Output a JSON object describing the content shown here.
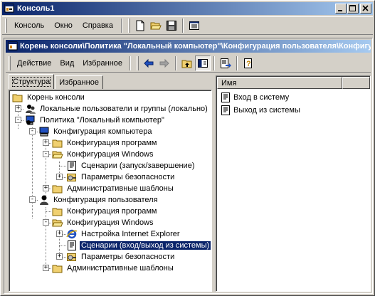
{
  "app": {
    "title": "Консоль1"
  },
  "menubar": {
    "items": [
      {
        "label": "Консоль"
      },
      {
        "label": "Окно"
      },
      {
        "label": "Справка"
      }
    ]
  },
  "child": {
    "title": "Корень консоли\\Политика \"Локальный компьютер\"\\Конфигурация пользователя\\Конфигурация Windows\\Сценарии (вход/выход из системы)"
  },
  "toolbar2": {
    "action_label": "Действие",
    "view_label": "Вид",
    "favorites_label": "Избранное"
  },
  "tabs": [
    {
      "label": "Структура",
      "active": true
    },
    {
      "label": "Избранное",
      "active": false
    }
  ],
  "tree": [
    {
      "label": "Корень консоли"
    },
    {
      "label": "Локальные пользователи и группы (локально)"
    },
    {
      "label": "Политика \"Локальный компьютер\""
    },
    {
      "label": "Конфигурация компьютера"
    },
    {
      "label": "Конфигурация программ"
    },
    {
      "label": "Конфигурация Windows"
    },
    {
      "label": "Сценарии (запуск/завершение)"
    },
    {
      "label": "Параметры безопасности"
    },
    {
      "label": "Административные шаблоны"
    },
    {
      "label": "Конфигурация пользователя"
    },
    {
      "label": "Конфигурация программ"
    },
    {
      "label": "Конфигурация Windows"
    },
    {
      "label": "Настройка Internet Explorer"
    },
    {
      "label": "Сценарии (вход/выход из системы)"
    },
    {
      "label": "Параметры безопасности"
    },
    {
      "label": "Административные шаблоны"
    }
  ],
  "list": {
    "column_name": "Имя",
    "items": [
      {
        "label": "Вход в систему"
      },
      {
        "label": "Выход из системы"
      }
    ]
  },
  "colors": {
    "title_active": "#0a246a",
    "title_gradient_end": "#a6caf0",
    "face": "#d4d0c8",
    "selection": "#0a246a",
    "folder": "#f0d070"
  }
}
